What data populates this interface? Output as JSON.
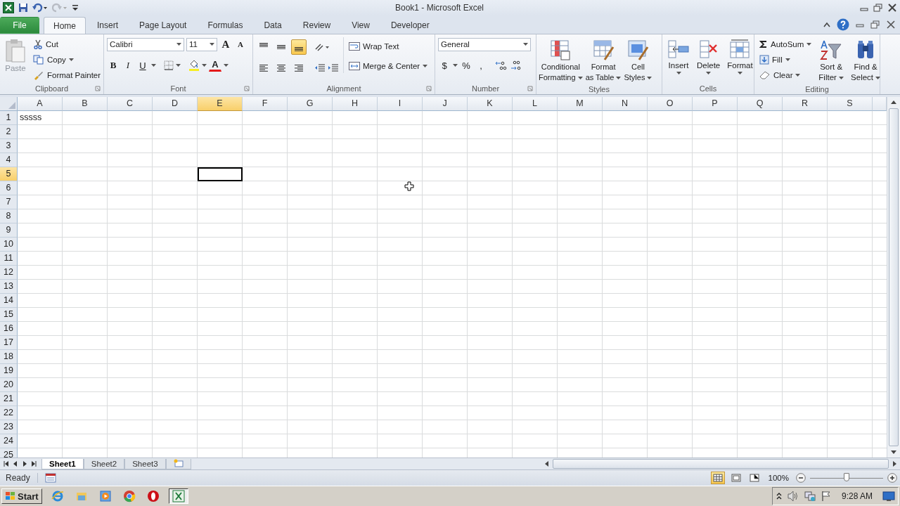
{
  "window": {
    "title": "Book1 - Microsoft Excel"
  },
  "tabs": [
    {
      "label": "File",
      "kind": "file",
      "selected": false
    },
    {
      "label": "Home",
      "kind": "tab",
      "selected": true
    },
    {
      "label": "Insert",
      "kind": "tab",
      "selected": false
    },
    {
      "label": "Page Layout",
      "kind": "tab",
      "selected": false
    },
    {
      "label": "Formulas",
      "kind": "tab",
      "selected": false
    },
    {
      "label": "Data",
      "kind": "tab",
      "selected": false
    },
    {
      "label": "Review",
      "kind": "tab",
      "selected": false
    },
    {
      "label": "View",
      "kind": "tab",
      "selected": false
    },
    {
      "label": "Developer",
      "kind": "tab",
      "selected": false
    }
  ],
  "ribbon": {
    "clipboard": {
      "label": "Clipboard",
      "paste": {
        "label": "Paste",
        "disabled": true
      },
      "cut": "Cut",
      "copy": "Copy",
      "format_painter": "Format Painter"
    },
    "font": {
      "label": "Font",
      "font_name": "Calibri",
      "font_size": "11",
      "grow": "A",
      "shrink": "A",
      "bold": "B",
      "italic": "I",
      "underline": "U",
      "font_color": "A"
    },
    "alignment": {
      "label": "Alignment",
      "vertical_align": [
        {
          "selected": false
        },
        {
          "selected": false
        },
        {
          "selected": true
        }
      ],
      "wrap_text": "Wrap Text",
      "merge": "Merge & Center"
    },
    "number": {
      "label": "Number",
      "format": "General",
      "currency": "$",
      "percent": "%",
      "comma": ","
    },
    "styles": {
      "label": "Styles",
      "buttons": [
        {
          "lines": [
            "Conditional",
            "Formatting"
          ]
        },
        {
          "lines": [
            "Format",
            "as Table"
          ]
        },
        {
          "lines": [
            "Cell",
            "Styles"
          ]
        }
      ]
    },
    "cells": {
      "label": "Cells",
      "buttons": [
        "Insert",
        "Delete",
        "Format"
      ]
    },
    "editing": {
      "label": "Editing",
      "autosum": "AutoSum",
      "fill": "Fill",
      "clear": "Clear",
      "big": [
        {
          "lines": [
            "Sort &",
            "Filter"
          ]
        },
        {
          "lines": [
            "Find &",
            "Select"
          ]
        }
      ]
    }
  },
  "columns": [
    {
      "label": "A",
      "selected": false
    },
    {
      "label": "B",
      "selected": false
    },
    {
      "label": "C",
      "selected": false
    },
    {
      "label": "D",
      "selected": false
    },
    {
      "label": "E",
      "selected": true
    },
    {
      "label": "F",
      "selected": false
    },
    {
      "label": "G",
      "selected": false
    },
    {
      "label": "H",
      "selected": false
    },
    {
      "label": "I",
      "selected": false
    },
    {
      "label": "J",
      "selected": false
    },
    {
      "label": "K",
      "selected": false
    },
    {
      "label": "L",
      "selected": false
    },
    {
      "label": "M",
      "selected": false
    },
    {
      "label": "N",
      "selected": false
    },
    {
      "label": "O",
      "selected": false
    },
    {
      "label": "P",
      "selected": false
    },
    {
      "label": "Q",
      "selected": false
    },
    {
      "label": "R",
      "selected": false
    },
    {
      "label": "S",
      "selected": false
    }
  ],
  "rows": [
    {
      "label": "1",
      "selected": false,
      "cells": [
        "sssss"
      ]
    },
    {
      "label": "2",
      "selected": false
    },
    {
      "label": "3",
      "selected": false
    },
    {
      "label": "4",
      "selected": false
    },
    {
      "label": "5",
      "selected": true
    },
    {
      "label": "6",
      "selected": false
    },
    {
      "label": "7",
      "selected": false
    },
    {
      "label": "8",
      "selected": false
    },
    {
      "label": "9",
      "selected": false
    },
    {
      "label": "10",
      "selected": false
    },
    {
      "label": "11",
      "selected": false
    },
    {
      "label": "12",
      "selected": false
    },
    {
      "label": "13",
      "selected": false
    },
    {
      "label": "14",
      "selected": false
    },
    {
      "label": "15",
      "selected": false
    },
    {
      "label": "16",
      "selected": false
    },
    {
      "label": "17",
      "selected": false
    },
    {
      "label": "18",
      "selected": false
    },
    {
      "label": "19",
      "selected": false
    },
    {
      "label": "20",
      "selected": false
    },
    {
      "label": "21",
      "selected": false
    },
    {
      "label": "22",
      "selected": false
    },
    {
      "label": "23",
      "selected": false
    },
    {
      "label": "24",
      "selected": false
    },
    {
      "label": "25",
      "selected": false
    }
  ],
  "sheet_tabs": [
    {
      "label": "Sheet1",
      "selected": true
    },
    {
      "label": "Sheet2",
      "selected": false
    },
    {
      "label": "Sheet3",
      "selected": false
    }
  ],
  "status_bar": {
    "text": "Ready",
    "views": [
      {
        "selected": true
      },
      {
        "selected": false
      },
      {
        "selected": false
      }
    ],
    "zoom": "100%",
    "zoom_slider": {
      "level": 0.5
    }
  },
  "taskbar": {
    "start": "Start",
    "apps": [
      {
        "kind": "ie",
        "selected": false
      },
      {
        "kind": "folder",
        "selected": false
      },
      {
        "kind": "media",
        "selected": false
      },
      {
        "kind": "chrome",
        "selected": false
      },
      {
        "kind": "opera",
        "selected": false
      },
      {
        "kind": "excel",
        "selected": true
      }
    ],
    "clock": "9:28 AM"
  }
}
